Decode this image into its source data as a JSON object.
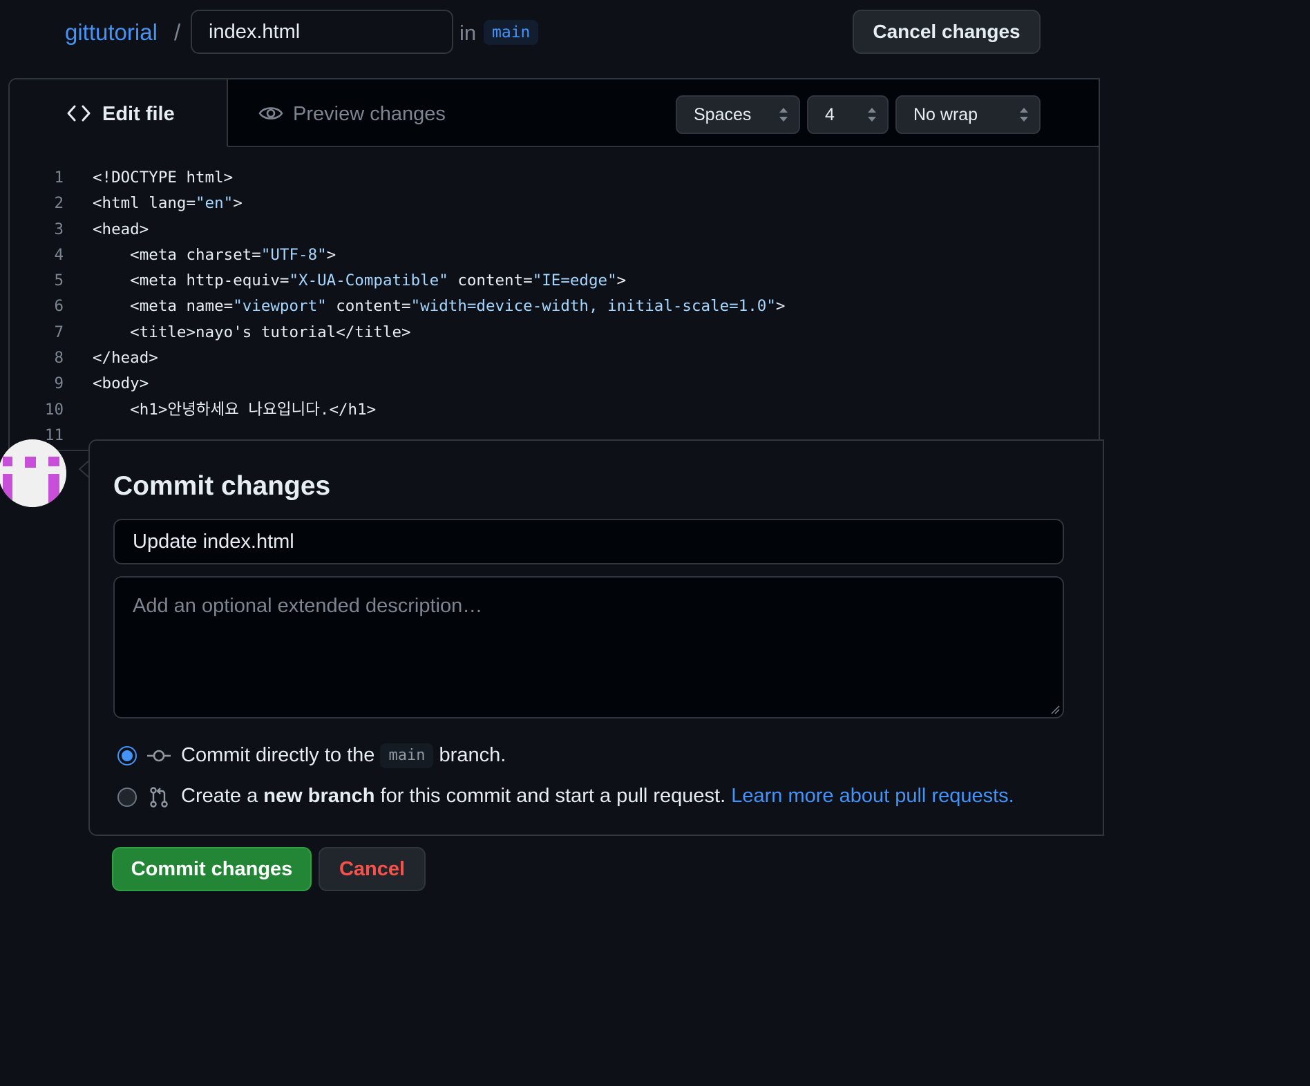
{
  "header": {
    "repo": "gittutorial",
    "separator": "/",
    "filename": "index.html",
    "in_label": "in",
    "branch": "main",
    "cancel_label": "Cancel changes"
  },
  "editor": {
    "tabs": {
      "edit": "Edit file",
      "preview": "Preview changes"
    },
    "indent_mode": "Spaces",
    "indent_size": "4",
    "wrap_mode": "No wrap",
    "lines": [
      {
        "n": "1",
        "parts": [
          [
            "<!DOCTYPE html>",
            ""
          ]
        ]
      },
      {
        "n": "2",
        "parts": [
          [
            "<html lang=",
            ""
          ],
          [
            "\"en\"",
            "str"
          ],
          [
            ">",
            ""
          ]
        ]
      },
      {
        "n": "3",
        "parts": [
          [
            "<head>",
            ""
          ]
        ]
      },
      {
        "n": "4",
        "parts": [
          [
            "    <meta charset=",
            ""
          ],
          [
            "\"UTF-8\"",
            "str"
          ],
          [
            ">",
            ""
          ]
        ]
      },
      {
        "n": "5",
        "parts": [
          [
            "    <meta http-equiv=",
            ""
          ],
          [
            "\"X-UA-Compatible\"",
            "str"
          ],
          [
            " content=",
            ""
          ],
          [
            "\"IE=edge\"",
            "str"
          ],
          [
            ">",
            ""
          ]
        ]
      },
      {
        "n": "6",
        "parts": [
          [
            "    <meta name=",
            ""
          ],
          [
            "\"viewport\"",
            "str"
          ],
          [
            " content=",
            ""
          ],
          [
            "\"width=device-width, initial-scale=1.0\"",
            "str"
          ],
          [
            ">",
            ""
          ]
        ]
      },
      {
        "n": "7",
        "parts": [
          [
            "    <title>nayo's tutorial</title>",
            ""
          ]
        ]
      },
      {
        "n": "8",
        "parts": [
          [
            "</head>",
            ""
          ]
        ]
      },
      {
        "n": "9",
        "parts": [
          [
            "<body>",
            ""
          ]
        ]
      },
      {
        "n": "10",
        "parts": [
          [
            "    <h1>안녕하세요 나요입니다.</h1>",
            ""
          ]
        ]
      },
      {
        "n": "11",
        "parts": [
          [
            "",
            ""
          ]
        ]
      }
    ]
  },
  "commit": {
    "title": "Commit changes",
    "summary_value": "Update index.html",
    "description_placeholder": "Add an optional extended description…",
    "option_direct": {
      "before": "Commit directly to the",
      "branch": "main",
      "after": "branch.",
      "selected": true
    },
    "option_new_branch": {
      "before": "Create a",
      "bold": "new branch",
      "after": "for this commit and start a pull request.",
      "link": "Learn more about pull requests.",
      "selected": false
    },
    "submit_label": "Commit changes",
    "cancel_label": "Cancel"
  },
  "colors": {
    "background": "#0d1117",
    "accent": "#4493f8",
    "primary_button": "#238636",
    "danger": "#f85149",
    "avatar_accent": "#c850d8"
  },
  "icons": [
    "code-icon",
    "eye-icon",
    "select-arrows-icon",
    "git-commit-icon",
    "git-pull-request-icon",
    "resize-handle-icon"
  ]
}
